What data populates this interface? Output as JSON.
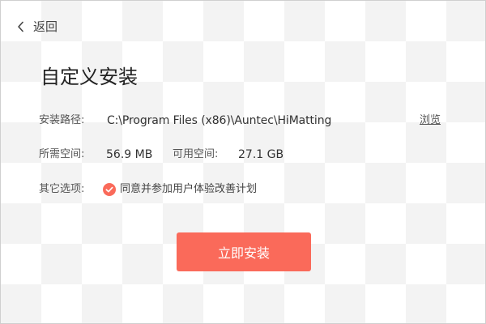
{
  "header": {
    "back_label": "返回",
    "back_icon": "chevron-left-icon"
  },
  "page": {
    "title": "自定义安装"
  },
  "install_path": {
    "label": "安装路径:",
    "value": "C:\\Program Files (x86)\\Auntec\\HiMatting",
    "browse_label": "浏览"
  },
  "space": {
    "required_label": "所需空间:",
    "required_value": "56.9 MB",
    "available_label": "可用空间:",
    "available_value": "27.1 GB"
  },
  "options": {
    "label": "其它选项:",
    "ux_program_label": "同意并参加用户体验改善计划",
    "ux_program_checked": true,
    "check_icon": "check-circle-icon"
  },
  "actions": {
    "install_label": "立即安装"
  },
  "colors": {
    "accent": "#fa6a5a",
    "text": "#333333"
  }
}
